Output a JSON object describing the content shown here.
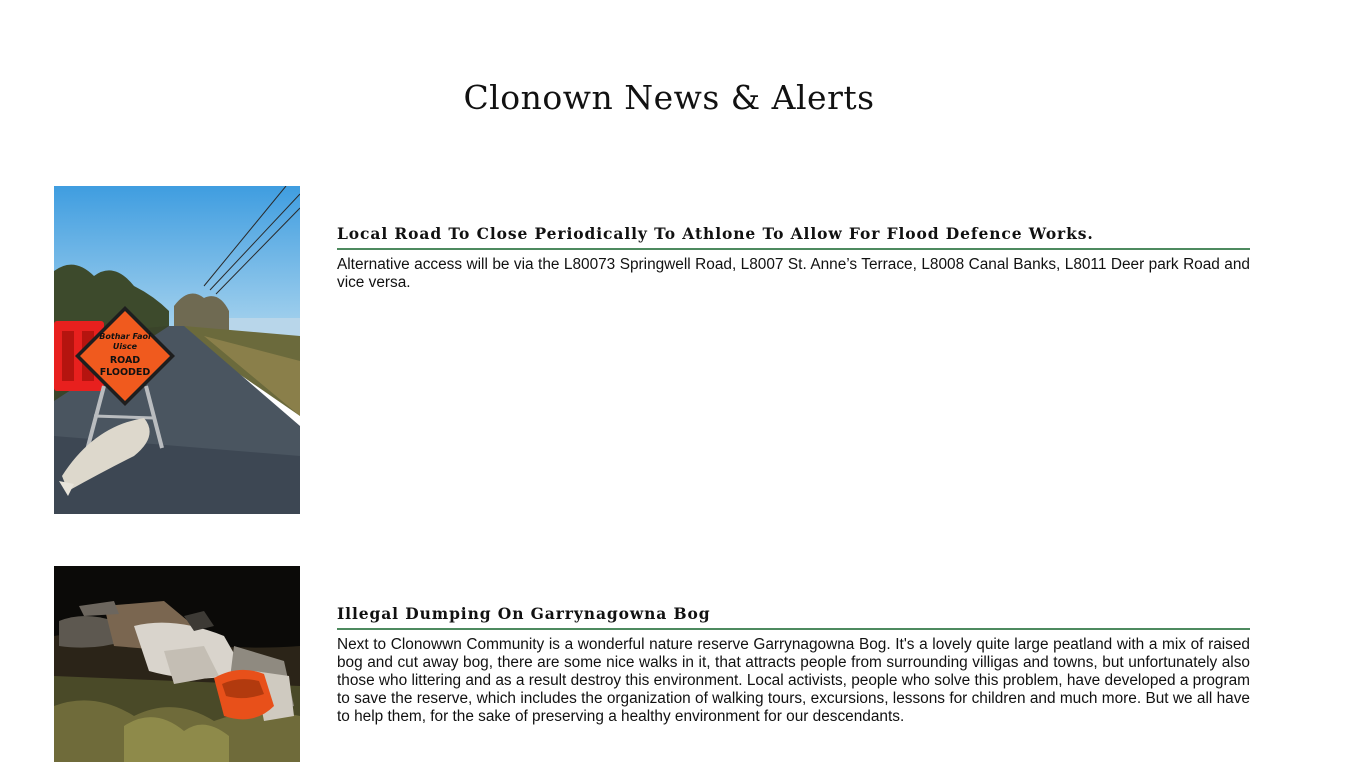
{
  "page": {
    "title": "Clonown News & Alerts"
  },
  "articles": [
    {
      "headline": "Local Road To Close Periodically To Athlone To Allow For Flood Defence Works.",
      "summary": "Alternative access will be via the L80073 Springwell Road, L8007 St. Anne’s Terrace, L8008 Canal Banks, L8011 Deer park Road and vice versa.",
      "image": {
        "subject": "flooded road sign photo",
        "sign_text": [
          "Bothar Faoi",
          "Uisce",
          "ROAD",
          "FLOODED"
        ]
      }
    },
    {
      "headline": "Illegal Dumping On Garrynagowna Bog",
      "summary": "Next to Clonowwn Community is a wonderful nature reserve Garrynagowna Bog. It's a lovely quite large peatland with a mix of raised bog and cut away bog, there are some nice walks in it, that attracts people from surrounding villigas and towns, but unfortunately also those who littering and as a result destroy this environment. Local activists, people who solve this problem, have developed a program to save the reserve, which includes the organization of walking tours, excursions, lessons for children and much more. But we all have to help them, for the sake of preserving a healthy environment for our descendants.",
      "image": {
        "subject": "illegal dumping photo at night"
      }
    }
  ],
  "colors": {
    "headline_rule": "#4e8a5f",
    "sign_orange": "#f05a1e",
    "barrier_red": "#e8201e"
  }
}
